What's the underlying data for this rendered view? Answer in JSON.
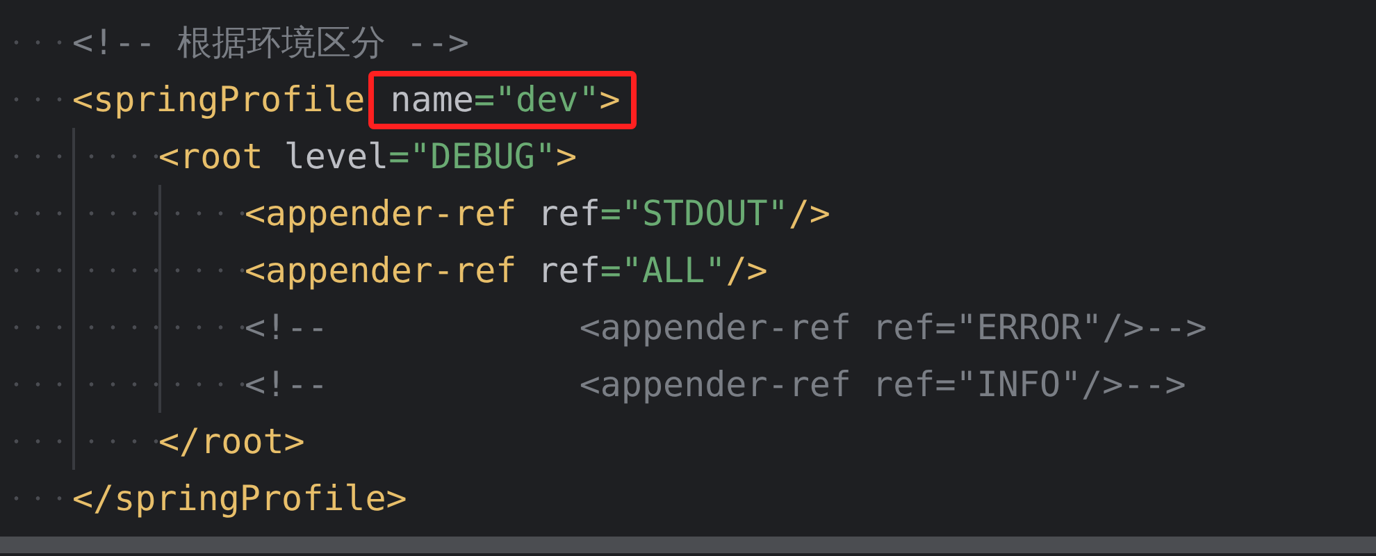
{
  "editor": {
    "lines": [
      {
        "tokens": [
          {
            "kind": "comment",
            "text": "<!-- 根据环境区分 -->"
          }
        ]
      },
      {
        "tokens": [
          {
            "kind": "tag",
            "text": "<springProfile"
          }
        ],
        "highlight": {
          "tokens": [
            {
              "kind": "attr",
              "text": "name"
            },
            {
              "kind": "string",
              "text": "=\"dev\""
            },
            {
              "kind": "tag",
              "text": ">"
            }
          ]
        },
        "children": [
          {
            "tokens": [
              {
                "kind": "tag",
                "text": "<root"
              },
              {
                "kind": "attr",
                "text": " level"
              },
              {
                "kind": "string",
                "text": "=\"DEBUG\""
              },
              {
                "kind": "tag",
                "text": ">"
              }
            ],
            "children": [
              {
                "tokens": [
                  {
                    "kind": "tag",
                    "text": "<appender-ref"
                  },
                  {
                    "kind": "attr",
                    "text": " ref"
                  },
                  {
                    "kind": "string",
                    "text": "=\"STDOUT\""
                  },
                  {
                    "kind": "tag",
                    "text": "/>"
                  }
                ]
              },
              {
                "tokens": [
                  {
                    "kind": "tag",
                    "text": "<appender-ref"
                  },
                  {
                    "kind": "attr",
                    "text": " ref"
                  },
                  {
                    "kind": "string",
                    "text": "=\"ALL\""
                  },
                  {
                    "kind": "tag",
                    "text": "/>"
                  }
                ]
              },
              {
                "tokens": [
                  {
                    "kind": "comment",
                    "text": "<!--            <appender-ref ref=\"ERROR\"/>-->"
                  }
                ]
              },
              {
                "tokens": [
                  {
                    "kind": "comment",
                    "text": "<!--            <appender-ref ref=\"INFO\"/>-->"
                  }
                ]
              }
            ]
          },
          {
            "tokens": [
              {
                "kind": "tag",
                "text": "</root>"
              }
            ]
          }
        ]
      },
      {
        "tokens": [
          {
            "kind": "tag",
            "text": "</springProfile>"
          }
        ]
      }
    ]
  }
}
